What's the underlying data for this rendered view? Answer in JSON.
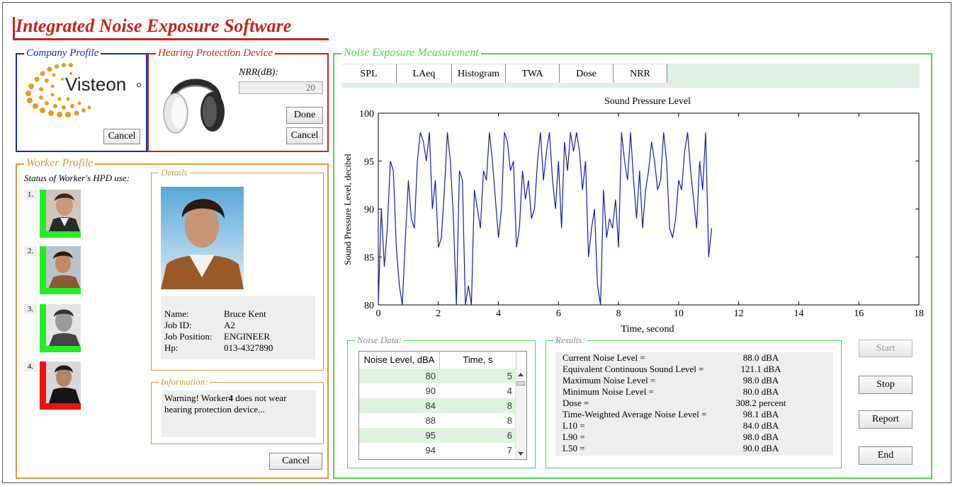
{
  "app_title": "Integrated Noise Exposure Software",
  "company_profile": {
    "label": "Company Profile",
    "logo_text": "Visteon",
    "cancel_label": "Cancel"
  },
  "hpd": {
    "label": "Hearing Protection Device",
    "nrr_label": "NRR(dB):",
    "nrr_value": "20",
    "done_label": "Done",
    "cancel_label": "Cancel"
  },
  "worker_profile": {
    "label": "Worker Profile",
    "status_label": "Status of Worker's HPD use:",
    "workers": [
      {
        "num": "1.",
        "status_color": "#22ee22"
      },
      {
        "num": "2.",
        "status_color": "#22ee22"
      },
      {
        "num": "3.",
        "status_color": "#22ee22"
      },
      {
        "num": "4.",
        "status_color": "#ee1111"
      }
    ],
    "details_label": "Details",
    "details": {
      "name_key": "Name:",
      "name_val": "Bruce Kent",
      "jobid_key": "Job ID:",
      "jobid_val": "A2",
      "jobpos_key": "Job Position:",
      "jobpos_val": "ENGINEER",
      "hp_key": "Hp:",
      "hp_val": "013-4327890"
    },
    "information_label": "Information:",
    "information_text_1": "Warning! Worker",
    "information_worker": "4",
    "information_text_2": " does not wear hearing protection device...",
    "cancel_label": "Cancel"
  },
  "measurement": {
    "label": "Noise Exposure Measurement",
    "tabs": [
      "SPL",
      "LAeq",
      "Histogram",
      "TWA",
      "Dose",
      "NRR"
    ],
    "chart_title": "Sound Pressure Level",
    "xlabel": "Time, second",
    "ylabel": "Sound Pressure Level, decibel",
    "x_ticks": [
      "0",
      "2",
      "4",
      "6",
      "8",
      "10",
      "12",
      "14",
      "16",
      "18"
    ],
    "y_ticks": [
      "80",
      "85",
      "90",
      "95",
      "100"
    ]
  },
  "chart_data": {
    "type": "line",
    "title": "Sound Pressure Level",
    "xlabel": "Time, second",
    "ylabel": "Sound Pressure Level, decibel",
    "xlim": [
      0,
      18
    ],
    "ylim": [
      80,
      100
    ],
    "grid": false,
    "x_step": 0.1,
    "values": [
      80,
      90,
      84,
      88,
      95,
      94,
      86,
      82,
      80,
      87,
      93,
      89,
      88,
      95,
      98,
      97,
      95,
      98,
      90,
      93,
      86,
      87,
      92,
      98,
      95,
      89,
      80,
      94,
      93,
      80,
      82,
      80,
      92,
      90,
      88,
      94,
      93,
      98,
      95,
      91,
      87,
      90,
      98,
      97,
      94,
      95,
      86,
      88,
      94,
      91,
      93,
      89,
      90,
      95,
      98,
      93,
      96,
      98,
      93,
      90,
      95,
      88,
      97,
      94,
      98,
      96,
      98,
      96,
      92,
      95,
      85,
      88,
      90,
      82,
      80,
      92,
      87,
      89,
      88,
      91,
      86,
      98,
      95,
      93,
      98,
      93,
      89,
      94,
      88,
      92,
      94,
      97,
      95,
      92,
      93,
      98,
      95,
      88,
      87,
      89,
      93,
      92,
      96,
      98,
      94,
      91,
      88,
      95,
      92,
      98,
      85,
      88
    ]
  },
  "noise_data": {
    "label": "Noise Data:",
    "col_level": "Noise Level, dBA",
    "col_time": "Time, s",
    "rows": [
      {
        "level": "80",
        "time": "5"
      },
      {
        "level": "90",
        "time": "4"
      },
      {
        "level": "84",
        "time": "8"
      },
      {
        "level": "88",
        "time": "8"
      },
      {
        "level": "95",
        "time": "6"
      },
      {
        "level": "94",
        "time": "7"
      }
    ]
  },
  "results": {
    "label": "Results:",
    "rows": [
      {
        "k": "Current Noise Level =",
        "v": "88.0 dBA"
      },
      {
        "k": "Equivalent Continuous Sound Level =",
        "v": "121.1 dBA"
      },
      {
        "k": "Maximum Noise Level =",
        "v": "98.0 dBA"
      },
      {
        "k": "Minimum Noise Level =",
        "v": "80.0 dBA"
      },
      {
        "k": "Dose =",
        "v": "308.2 percent"
      },
      {
        "k": "Time-Weighted Average Noise Level =",
        "v": "98.1 dBA"
      },
      {
        "k": "L10 =",
        "v": "84.0 dBA"
      },
      {
        "k": "L90 =",
        "v": "98.0 dBA"
      },
      {
        "k": "L50 =",
        "v": "90.0 dBA"
      }
    ]
  },
  "controls": {
    "start_label": "Start",
    "stop_label": "Stop",
    "report_label": "Report",
    "end_label": "End"
  },
  "colors": {
    "title_red": "#c8241c",
    "company_blue": "#1a2ea8",
    "hpd_red": "#c8241c",
    "worker_orange": "#d89a3e",
    "measure_green": "#4cd84c",
    "line_blue": "#1a1aa8"
  }
}
